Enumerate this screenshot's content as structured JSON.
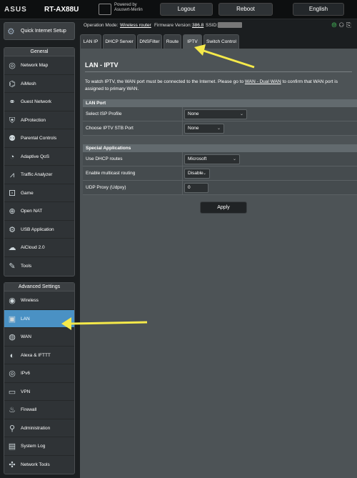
{
  "header": {
    "brand": "ASUS",
    "model": "RT-AX88U",
    "powered_by": "Powered by\nAsuswrt-Merlin",
    "logout_label": "Logout",
    "reboot_label": "Reboot",
    "language_label": "English"
  },
  "status_bar": {
    "op_mode_label": "Operation Mode:",
    "op_mode_value": "Wireless router",
    "firmware_label": "Firmware Version:",
    "firmware_value": "386.8",
    "ssid_label": "SSID:"
  },
  "sidebar": {
    "qis_label": "Quick Internet Setup",
    "general_title": "General",
    "general_items": [
      {
        "label": "Network Map",
        "icon": "network-map-icon"
      },
      {
        "label": "AiMesh",
        "icon": "aimesh-icon"
      },
      {
        "label": "Guest Network",
        "icon": "guest-network-icon"
      },
      {
        "label": "AiProtection",
        "icon": "aiprotection-icon"
      },
      {
        "label": "Parental Controls",
        "icon": "parental-controls-icon"
      },
      {
        "label": "Adaptive QoS",
        "icon": "adaptive-qos-icon"
      },
      {
        "label": "Traffic Analyzer",
        "icon": "traffic-analyzer-icon"
      },
      {
        "label": "Game",
        "icon": "game-icon"
      },
      {
        "label": "Open NAT",
        "icon": "open-nat-icon"
      },
      {
        "label": "USB Application",
        "icon": "usb-application-icon"
      },
      {
        "label": "AiCloud 2.0",
        "icon": "aicloud-icon"
      },
      {
        "label": "Tools",
        "icon": "tools-icon"
      }
    ],
    "advanced_title": "Advanced Settings",
    "advanced_items": [
      {
        "label": "Wireless",
        "icon": "wireless-icon"
      },
      {
        "label": "LAN",
        "icon": "lan-icon"
      },
      {
        "label": "WAN",
        "icon": "wan-icon"
      },
      {
        "label": "Alexa & IFTTT",
        "icon": "alexa-ifttt-icon"
      },
      {
        "label": "IPv6",
        "icon": "ipv6-icon"
      },
      {
        "label": "VPN",
        "icon": "vpn-icon"
      },
      {
        "label": "Firewall",
        "icon": "firewall-icon"
      },
      {
        "label": "Administration",
        "icon": "administration-icon"
      },
      {
        "label": "System Log",
        "icon": "system-log-icon"
      },
      {
        "label": "Network Tools",
        "icon": "network-tools-icon"
      }
    ]
  },
  "tabs": [
    "LAN IP",
    "DHCP Server",
    "DNSFilter",
    "Route",
    "IPTV",
    "Switch Control"
  ],
  "main": {
    "title": "LAN - IPTV",
    "desc_pre": "To watch IPTV, the WAN port must be connected to the Internet. Please go to ",
    "desc_link": "WAN - Dual WAN",
    "desc_post": " to confirm that WAN port is assigned to primary WAN.",
    "lan_port": {
      "header": "LAN Port",
      "isp_profile_label": "Select ISP Profile",
      "isp_profile_value": "None",
      "stb_port_label": "Choose IPTV STB Port",
      "stb_port_value": "None"
    },
    "special": {
      "header": "Special Applications",
      "dhcp_routes_label": "Use DHCP routes",
      "dhcp_routes_value": "Microsoft",
      "multicast_label": "Enable multicast routing",
      "multicast_value": "Disable",
      "udpxy_label": "UDP Proxy (Udpxy)",
      "udpxy_value": "0"
    },
    "apply_label": "Apply"
  },
  "colors": {
    "annotation_arrow": "#f5e94a",
    "active_nav": "#4a91c4",
    "panel_bg": "#4d5356"
  }
}
